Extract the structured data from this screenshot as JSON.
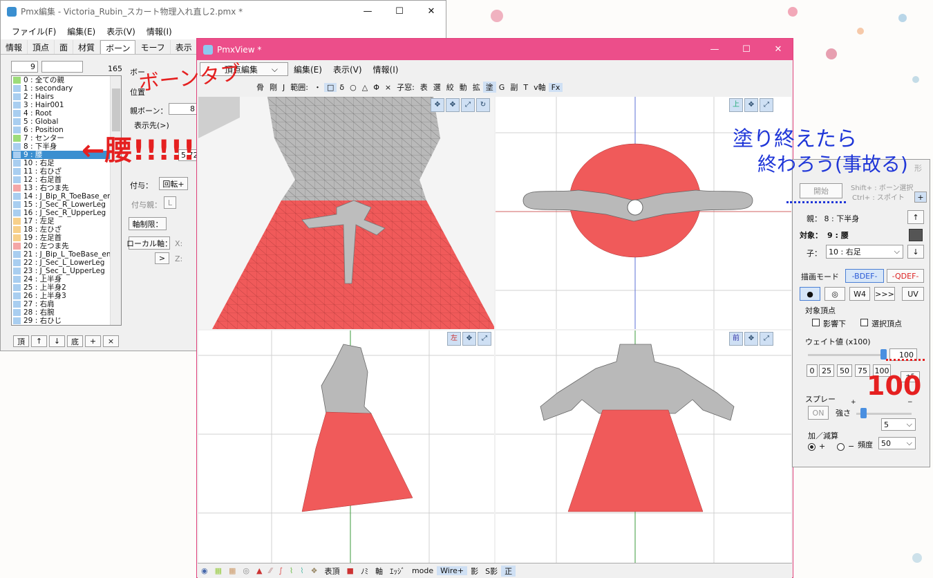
{
  "pmx_editor": {
    "title": "Pmx編集 - Victoria_Rubin_スカート物理入れ直し2.pmx *",
    "menus": [
      "ファイル(F)",
      "編集(E)",
      "表示(V)",
      "情報(I)"
    ],
    "tabs": [
      "情報",
      "頂点",
      "面",
      "材質",
      "ボーン",
      "モーフ",
      "表示"
    ],
    "active_tab": "ボーン",
    "index_value": "9",
    "count": "165",
    "bones": [
      {
        "label": "0 : 全ての親",
        "color": "#9ddc7a"
      },
      {
        "label": "1 : secondary",
        "color": "#a9cef0"
      },
      {
        "label": "2 : Hairs",
        "color": "#a9cef0"
      },
      {
        "label": "3 : Hair001",
        "color": "#a9cef0"
      },
      {
        "label": "4 : Root",
        "color": "#a9cef0"
      },
      {
        "label": "5 : Global",
        "color": "#a9cef0"
      },
      {
        "label": "6 : Position",
        "color": "#a9cef0"
      },
      {
        "label": "7 : センター",
        "color": "#9ddc7a"
      },
      {
        "label": "8 : 下半身",
        "color": "#a9cef0"
      },
      {
        "label": "9 : 腰",
        "color": "#a9cef0"
      },
      {
        "label": "10 : 右足",
        "color": "#a9cef0"
      },
      {
        "label": "11 : 右ひざ",
        "color": "#a9cef0"
      },
      {
        "label": "12 : 右足首",
        "color": "#a9cef0"
      },
      {
        "label": "13 : 右つま先",
        "color": "#f4a6a6"
      },
      {
        "label": "14 : J_Bip_R_ToeBase_er",
        "color": "#a9cef0"
      },
      {
        "label": "15 : J_Sec_R_LowerLeg",
        "color": "#a9cef0"
      },
      {
        "label": "16 : J_Sec_R_UpperLeg",
        "color": "#a9cef0"
      },
      {
        "label": "17 : 左足",
        "color": "#f7d08a"
      },
      {
        "label": "18 : 左ひざ",
        "color": "#f7d08a"
      },
      {
        "label": "19 : 左足首",
        "color": "#f7d08a"
      },
      {
        "label": "20 : 左つま先",
        "color": "#f4a6a6"
      },
      {
        "label": "21 : J_Bip_L_ToeBase_en",
        "color": "#a9cef0"
      },
      {
        "label": "22 : J_Sec_L_LowerLeg",
        "color": "#a9cef0"
      },
      {
        "label": "23 : J_Sec_L_UpperLeg",
        "color": "#a9cef0"
      },
      {
        "label": "24 : 上半身",
        "color": "#a9cef0"
      },
      {
        "label": "25 : 上半身2",
        "color": "#a9cef0"
      },
      {
        "label": "26 : 上半身3",
        "color": "#a9cef0"
      },
      {
        "label": "27 : 右肩",
        "color": "#a9cef0"
      },
      {
        "label": "28 : 右腕",
        "color": "#a9cef0"
      },
      {
        "label": "29 : 右ひじ",
        "color": "#a9cef0"
      }
    ],
    "selected_bone": "9 : 腰",
    "list_buttons": [
      "頂",
      "↑",
      "↓",
      "底",
      "+",
      "×"
    ],
    "props": {
      "bone_label": "ボー",
      "pos_label": "位置",
      "parent_label": "親ボーン：",
      "parent_value": "8",
      "display_label": "表示先(>)",
      "value_5722": "5.72",
      "fuyo_label": "付与：",
      "rot_btn": "回転+",
      "fuyo_parent": "付与親：",
      "fuyo_l": "L",
      "axis_limit": "軸制限：",
      "local_axis": "ローカル軸：",
      "x_label": "X:",
      "z_label": "Z:",
      "arrow_btn": ">"
    }
  },
  "pmx_view": {
    "title": "PmxView *",
    "menus": [
      "編集(E)",
      "表示(V)",
      "情報(I)"
    ],
    "mode_select": "頂点編集",
    "toolbar1": [
      "骨",
      "剛",
      "J",
      "範囲:",
      "・",
      "□",
      "δ",
      "○",
      "△",
      "Φ",
      "×",
      "子窓:",
      "表",
      "選",
      "絞",
      "動",
      "拡",
      "塗",
      "G",
      "副",
      "T",
      "v軸",
      "Fx"
    ],
    "viewport_labels": {
      "top": "上",
      "left": "左",
      "front": "前"
    },
    "bottom_toolbar": [
      "表頂",
      "ﾉﾐ",
      "軸",
      "ｴｯｼﾞ",
      "mode",
      "Wire+",
      "影",
      "S影",
      "正"
    ]
  },
  "weight_panel": {
    "start_btn": "開始",
    "hint1": "Shift+ : ボーン選択",
    "hint2": "Ctrl+ : スポイト",
    "plus_btn": "+",
    "parent": "親：  8 : 下半身",
    "target_label": "対象：",
    "target_value": "9 : 腰",
    "child_label": "子：",
    "child_value": "10 : 右足",
    "draw_mode": "描画モード",
    "bdef": "-BDEF-",
    "qdef": "-QDEF-",
    "brush_btns": [
      "●",
      "◎",
      "W4",
      ">>>",
      "UV"
    ],
    "target_vertices": "対象頂点",
    "cb_affected": "影響下",
    "cb_selected": "選択頂点",
    "weight_label": "ウェイト値 (x100)",
    "weight_value": "100",
    "presets": [
      "0",
      "25",
      "50",
      "75",
      "100",
      "±5"
    ],
    "spray": "スプレー",
    "on_btn": "ON",
    "strength": "強さ",
    "plus_sign": "+",
    "minus_sign": "−",
    "strength_value": "5",
    "add_sub": "加／減算",
    "radio_plus": "+",
    "radio_minus": "−",
    "freq": "頻度",
    "freq_value": "50",
    "faded_label": "形"
  },
  "annotations": {
    "bone_tab": "ボーンタブ",
    "koshi": "←腰!!!!!",
    "note1": "塗り終えたら",
    "note2": "終わろう(事故る)",
    "hundred": "100"
  }
}
